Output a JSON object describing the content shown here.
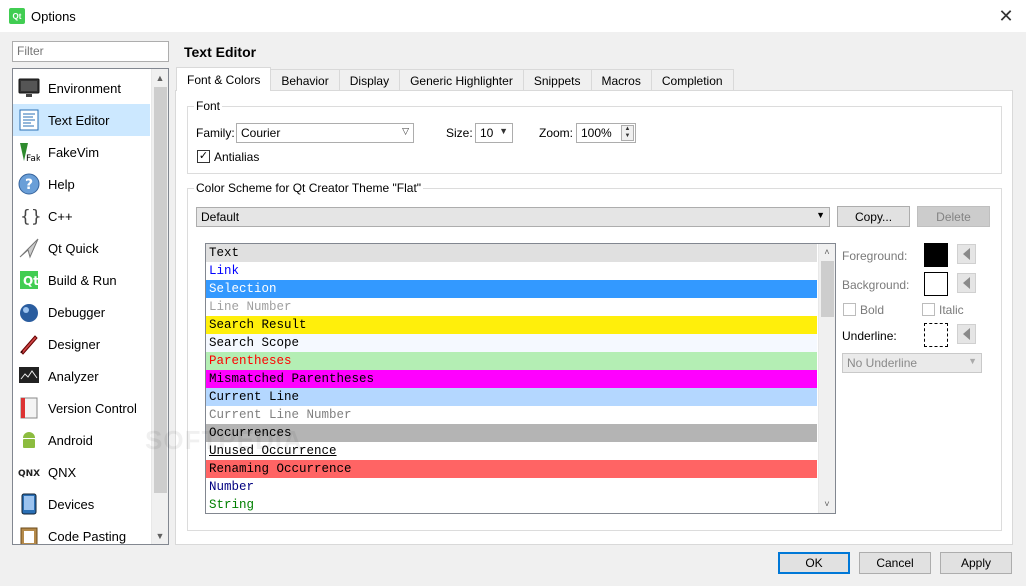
{
  "window": {
    "title": "Options",
    "app_icon_text": "Qt"
  },
  "filter": {
    "placeholder": "Filter"
  },
  "categories": [
    {
      "label": "Environment",
      "icon": "monitor-icon"
    },
    {
      "label": "Text Editor",
      "icon": "text-editor-icon",
      "selected": true
    },
    {
      "label": "FakeVim",
      "icon": "fakevim-icon"
    },
    {
      "label": "Help",
      "icon": "help-icon"
    },
    {
      "label": "C++",
      "icon": "braces-icon"
    },
    {
      "label": "Qt Quick",
      "icon": "qt-quick-icon"
    },
    {
      "label": "Build & Run",
      "icon": "build-run-icon"
    },
    {
      "label": "Debugger",
      "icon": "debugger-icon"
    },
    {
      "label": "Designer",
      "icon": "designer-icon"
    },
    {
      "label": "Analyzer",
      "icon": "analyzer-icon"
    },
    {
      "label": "Version Control",
      "icon": "version-control-icon"
    },
    {
      "label": "Android",
      "icon": "android-icon"
    },
    {
      "label": "QNX",
      "icon": "qnx-icon"
    },
    {
      "label": "Devices",
      "icon": "devices-icon"
    },
    {
      "label": "Code Pasting",
      "icon": "code-pasting-icon"
    }
  ],
  "section_title": "Text Editor",
  "tabs": [
    {
      "label": "Font & Colors",
      "active": true
    },
    {
      "label": "Behavior"
    },
    {
      "label": "Display"
    },
    {
      "label": "Generic Highlighter"
    },
    {
      "label": "Snippets"
    },
    {
      "label": "Macros"
    },
    {
      "label": "Completion"
    }
  ],
  "font": {
    "group_label": "Font",
    "family_label": "Family:",
    "family_value": "Courier",
    "size_label": "Size:",
    "size_value": "10",
    "zoom_label": "Zoom:",
    "zoom_value": "100%",
    "antialias_label": "Antialias",
    "antialias_checked": true
  },
  "color_scheme": {
    "group_label": "Color Scheme for Qt Creator Theme \"Flat\"",
    "scheme_value": "Default",
    "copy_label": "Copy...",
    "delete_label": "Delete"
  },
  "items": [
    {
      "label": "Text",
      "bg": "#e0e0e0",
      "fg": "#000000"
    },
    {
      "label": "Link",
      "bg": "#ffffff",
      "fg": "#0000ff"
    },
    {
      "label": "Selection",
      "bg": "#3399ff",
      "fg": "#ffffff"
    },
    {
      "label": "Line Number",
      "bg": "#ffffff",
      "fg": "#a0a0a0"
    },
    {
      "label": "Search Result",
      "bg": "#ffef0b",
      "fg": "#000000"
    },
    {
      "label": "Search Scope",
      "bg": "#f5f9ff",
      "fg": "#000000"
    },
    {
      "label": "Parentheses",
      "bg": "#b4eeb4",
      "fg": "#ff0000"
    },
    {
      "label": "Mismatched Parentheses",
      "bg": "#ff00ff",
      "fg": "#000000"
    },
    {
      "label": "Current Line",
      "bg": "#b4d7ff",
      "fg": "#000000"
    },
    {
      "label": "Current Line Number",
      "bg": "#ffffff",
      "fg": "#808080"
    },
    {
      "label": "Occurrences",
      "bg": "#b4b4b4",
      "fg": "#000000"
    },
    {
      "label": "Unused Occurrence",
      "bg": "#ffffff",
      "fg": "#000000",
      "underline": true
    },
    {
      "label": "Renaming Occurrence",
      "bg": "#ff6464",
      "fg": "#000000"
    },
    {
      "label": "Number",
      "bg": "#ffffff",
      "fg": "#000080"
    },
    {
      "label": "String",
      "bg": "#ffffff",
      "fg": "#008000"
    }
  ],
  "properties": {
    "foreground_label": "Foreground:",
    "foreground_color": "#000000",
    "background_label": "Background:",
    "background_color": "#ffffff",
    "bold_label": "Bold",
    "italic_label": "Italic",
    "underline_label": "Underline:",
    "underline_value": "No Underline"
  },
  "buttons": {
    "ok": "OK",
    "cancel": "Cancel",
    "apply": "Apply"
  },
  "watermark": "SOFTPEDIA"
}
